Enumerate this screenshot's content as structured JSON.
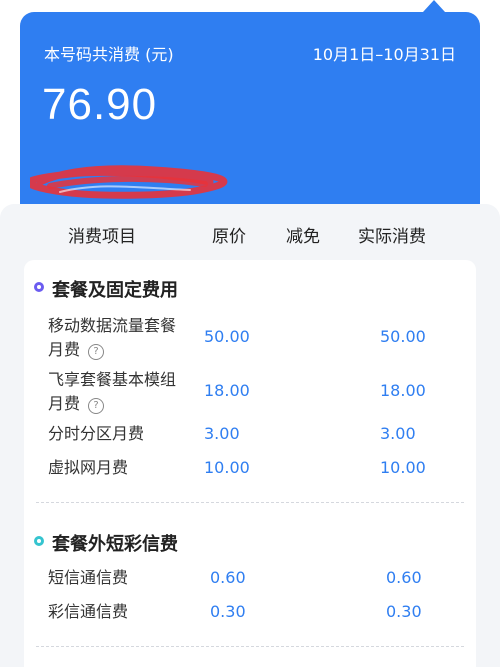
{
  "summary": {
    "total_label": "本号码共消费 (元)",
    "date_range": "10月1日–10月31日",
    "total_amount": "76.90"
  },
  "table_headers": {
    "item": "消费项目",
    "original": "原价",
    "discount": "减免",
    "actual": "实际消费"
  },
  "sections": [
    {
      "title": "套餐及固定费用",
      "rows": [
        {
          "name_line1": "移动数据流量套餐",
          "name_line2": "月费",
          "original": "50.00",
          "actual": "50.00"
        },
        {
          "name_line1": "飞享套餐基本模组",
          "name_line2": "月费",
          "original": "18.00",
          "actual": "18.00"
        },
        {
          "name_line1": "分时分区月费",
          "original": "3.00",
          "actual": "3.00"
        },
        {
          "name_line1": "虚拟网月费",
          "original": "10.00",
          "actual": "10.00"
        }
      ]
    },
    {
      "title": "套餐外短彩信费",
      "rows": [
        {
          "name_line1": "短信通信费",
          "original": "0.60",
          "actual": "0.60"
        },
        {
          "name_line1": "彩信通信费",
          "original": "0.30",
          "actual": "0.30"
        }
      ]
    }
  ],
  "help_icon_glyph": "?",
  "colors": {
    "primary_blue": "#2f7ef1",
    "dot_purple": "#6b5cf0",
    "dot_teal": "#35c4cf",
    "redaction_red": "#e8333a"
  }
}
